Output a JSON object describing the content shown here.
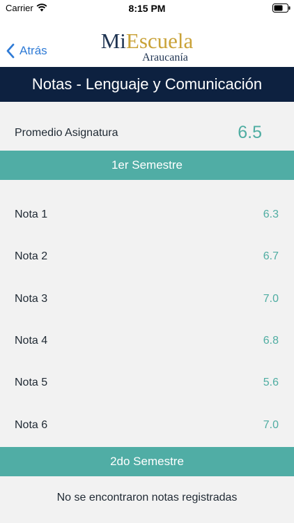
{
  "status_bar": {
    "carrier": "Carrier",
    "time": "8:15 PM",
    "wifi_icon": "wifi-icon",
    "battery_icon": "battery-icon"
  },
  "nav": {
    "back_label": "Atrás",
    "back_icon": "chevron-left-icon",
    "logo_mi": "Mi",
    "logo_escuela": "Escuela",
    "logo_sub": "Araucanía"
  },
  "subject": {
    "title": "Notas - Lenguaje y Comunicación"
  },
  "average": {
    "label": "Promedio Asignatura",
    "value": "6.5"
  },
  "semesters": [
    {
      "title": "1er Semestre",
      "grades": [
        {
          "label": "Nota 1",
          "value": "6.3"
        },
        {
          "label": "Nota 2",
          "value": "6.7"
        },
        {
          "label": "Nota 3",
          "value": "7.0"
        },
        {
          "label": "Nota 4",
          "value": "6.8"
        },
        {
          "label": "Nota 5",
          "value": "5.6"
        },
        {
          "label": "Nota 6",
          "value": "7.0"
        }
      ]
    },
    {
      "title": "2do Semestre",
      "empty_message": "No se encontraron notas registradas"
    }
  ],
  "colors": {
    "header_bg": "#0d2140",
    "section_bg": "#50ada5",
    "accent_value": "#4fada2",
    "link_blue": "#2f7bd6",
    "logo_gold": "#c9a238",
    "logo_navy": "#1e3351"
  }
}
